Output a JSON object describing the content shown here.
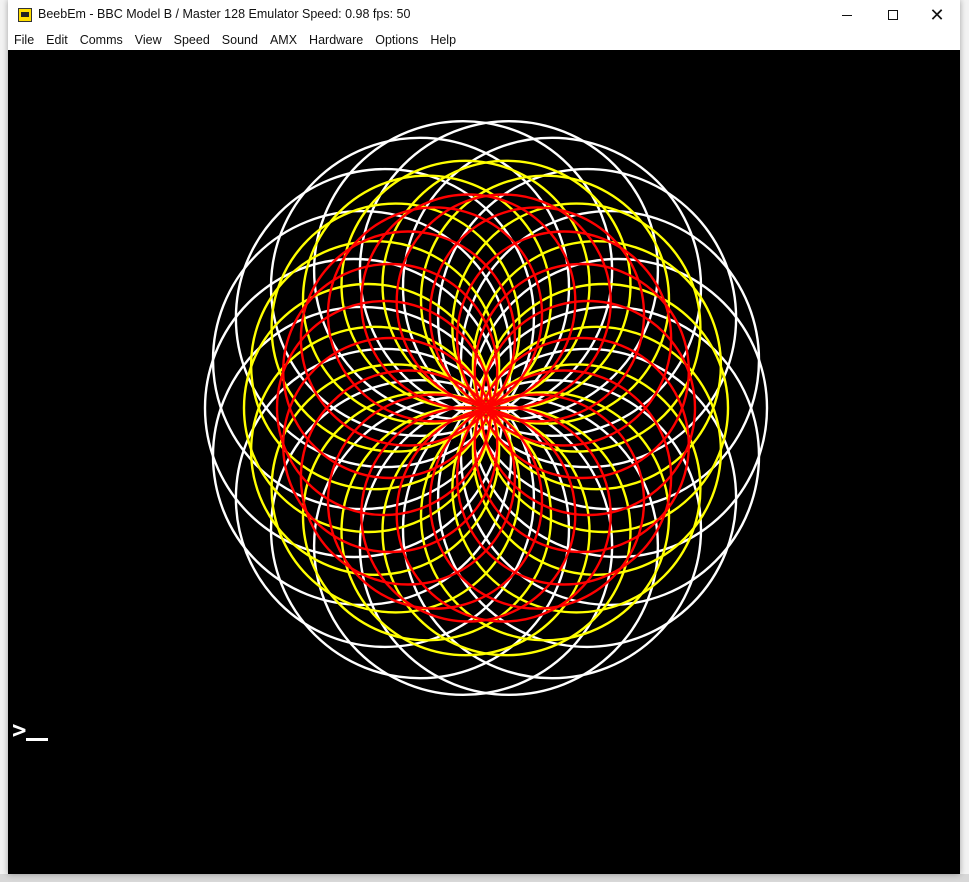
{
  "window": {
    "title": "BeebEm - BBC Model B / Master 128 Emulator  Speed: 0.98  fps: 50",
    "icon": "beebem-app-icon"
  },
  "controls": {
    "minimize_icon": "minimize-icon",
    "maximize_icon": "maximize-icon",
    "close_icon": "close-icon"
  },
  "menu": {
    "items": [
      "File",
      "Edit",
      "Comms",
      "View",
      "Speed",
      "Sound",
      "AMX",
      "Hardware",
      "Options",
      "Help"
    ]
  },
  "screen": {
    "prompt": ">",
    "background_color": "#000000",
    "pattern_colors": {
      "outer": "#ffffff",
      "middle": "#ffff00",
      "inner": "#ff0000"
    }
  }
}
